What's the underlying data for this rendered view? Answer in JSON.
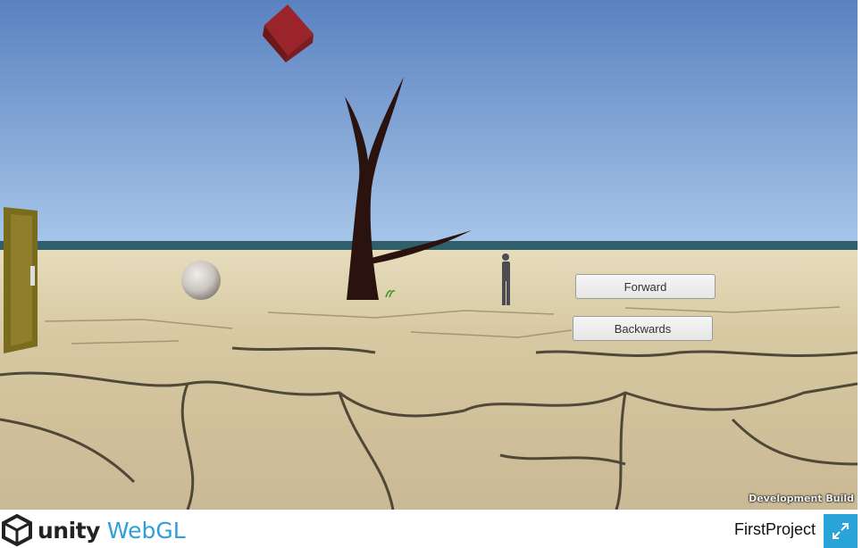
{
  "game": {
    "buttons": {
      "forward_label": "Forward",
      "backwards_label": "Backwards"
    },
    "build_label": "Development Build"
  },
  "footer": {
    "brand": "unity",
    "platform": "WebGL",
    "project_title": "FirstProject",
    "fullscreen_icon": "expand-arrows-icon"
  },
  "colors": {
    "sky_top": "#5e86c2",
    "sky_bottom": "#a6c4e8",
    "ground": "#d9caa0",
    "cube": "#8c1f24",
    "tree": "#2a120f",
    "door": "#7a6c1d",
    "fullscreen_button": "#2aa4d8",
    "webgl_text": "#2d9fd9"
  }
}
